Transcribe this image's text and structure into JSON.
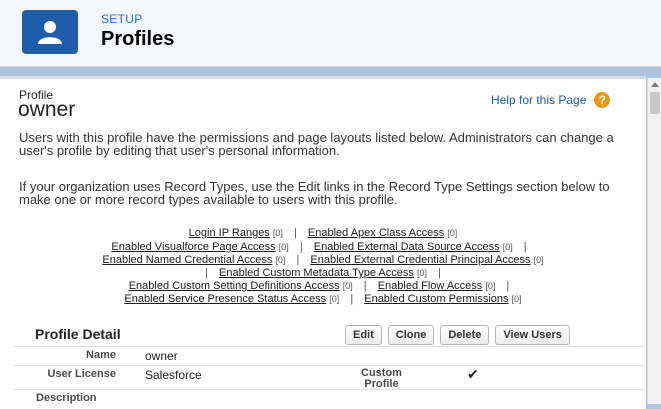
{
  "header": {
    "setup_label": "SETUP",
    "title": "Profiles",
    "icon": "user-icon",
    "icon_color": "#1f5da8"
  },
  "page": {
    "pre_title": "Profile",
    "title": "owner",
    "help_link": "Help for this Page",
    "help_icon_glyph": "?",
    "description": "Users with this profile have the permissions and page layouts listed below. Administrators can change a user's profile by editing that user's personal information.",
    "record_types_note": "If your organization uses Record Types, use the Edit links in the Record Type Settings section below to make one or more record types available to users with this profile."
  },
  "related_links": [
    {
      "label": "Login IP Ranges",
      "count": "[0]"
    },
    {
      "label": "Enabled Apex Class Access",
      "count": "[0]"
    },
    {
      "label": "Enabled Visualforce Page Access",
      "count": "[0]"
    },
    {
      "label": "Enabled External Data Source Access",
      "count": "[0]"
    },
    {
      "label": "Enabled Named Credential Access",
      "count": "[0]"
    },
    {
      "label": "Enabled External Credential Principal Access",
      "count": "[0]"
    },
    {
      "label": "Enabled Custom Metadata Type Access",
      "count": "[0]"
    },
    {
      "label": "Enabled Custom Setting Definitions Access",
      "count": "[0]"
    },
    {
      "label": "Enabled Flow Access",
      "count": "[0]"
    },
    {
      "label": "Enabled Service Presence Status Access",
      "count": "[0]"
    },
    {
      "label": "Enabled Custom Permissions",
      "count": "[0]"
    }
  ],
  "separator": "|",
  "detail": {
    "title": "Profile Detail",
    "buttons": {
      "edit": "Edit",
      "clone": "Clone",
      "delete": "Delete",
      "view_users": "View Users"
    },
    "fields": {
      "name_label": "Name",
      "name_value": "owner",
      "license_label": "User License",
      "license_value": "Salesforce",
      "custom_label": "Custom Profile",
      "custom_value": "✔",
      "description_label": "Description"
    }
  }
}
